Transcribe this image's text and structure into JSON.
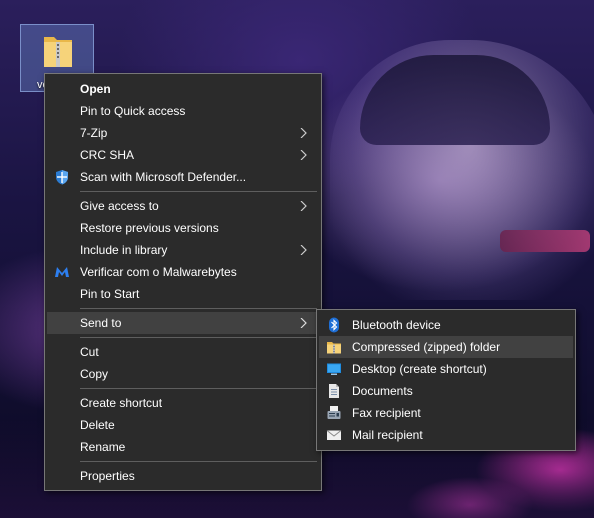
{
  "desktop": {
    "icon_label": "ve"
  },
  "context_menu": {
    "items": [
      {
        "label": "Open",
        "icon": "",
        "submenu": false
      },
      {
        "label": "Pin to Quick access",
        "icon": "",
        "submenu": false
      },
      {
        "label": "7-Zip",
        "icon": "",
        "submenu": true
      },
      {
        "label": "CRC SHA",
        "icon": "",
        "submenu": true
      },
      {
        "label": "Scan with Microsoft Defender...",
        "icon": "defender-shield-icon",
        "submenu": false
      },
      {
        "label": "Give access to",
        "icon": "",
        "submenu": true
      },
      {
        "label": "Restore previous versions",
        "icon": "",
        "submenu": false
      },
      {
        "label": "Include in library",
        "icon": "",
        "submenu": true
      },
      {
        "label": "Verificar com o Malwarebytes",
        "icon": "malwarebytes-icon",
        "submenu": false
      },
      {
        "label": "Pin to Start",
        "icon": "",
        "submenu": false
      },
      {
        "label": "Send to",
        "icon": "",
        "submenu": true
      },
      {
        "label": "Cut",
        "icon": "",
        "submenu": false
      },
      {
        "label": "Copy",
        "icon": "",
        "submenu": false
      },
      {
        "label": "Create shortcut",
        "icon": "",
        "submenu": false
      },
      {
        "label": "Delete",
        "icon": "",
        "submenu": false
      },
      {
        "label": "Rename",
        "icon": "",
        "submenu": false
      },
      {
        "label": "Properties",
        "icon": "",
        "submenu": false
      }
    ]
  },
  "send_to_menu": {
    "items": [
      {
        "label": "Bluetooth device",
        "icon": "bluetooth-icon"
      },
      {
        "label": "Compressed (zipped) folder",
        "icon": "zip-folder-icon"
      },
      {
        "label": "Desktop (create shortcut)",
        "icon": "desktop-icon"
      },
      {
        "label": "Documents",
        "icon": "documents-icon"
      },
      {
        "label": "Fax recipient",
        "icon": "fax-icon"
      },
      {
        "label": "Mail recipient",
        "icon": "mail-icon"
      }
    ]
  },
  "colors": {
    "menu_background": "#2b2b2b",
    "menu_highlight": "#414141",
    "menu_border": "#777777",
    "text": "#ffffff"
  }
}
